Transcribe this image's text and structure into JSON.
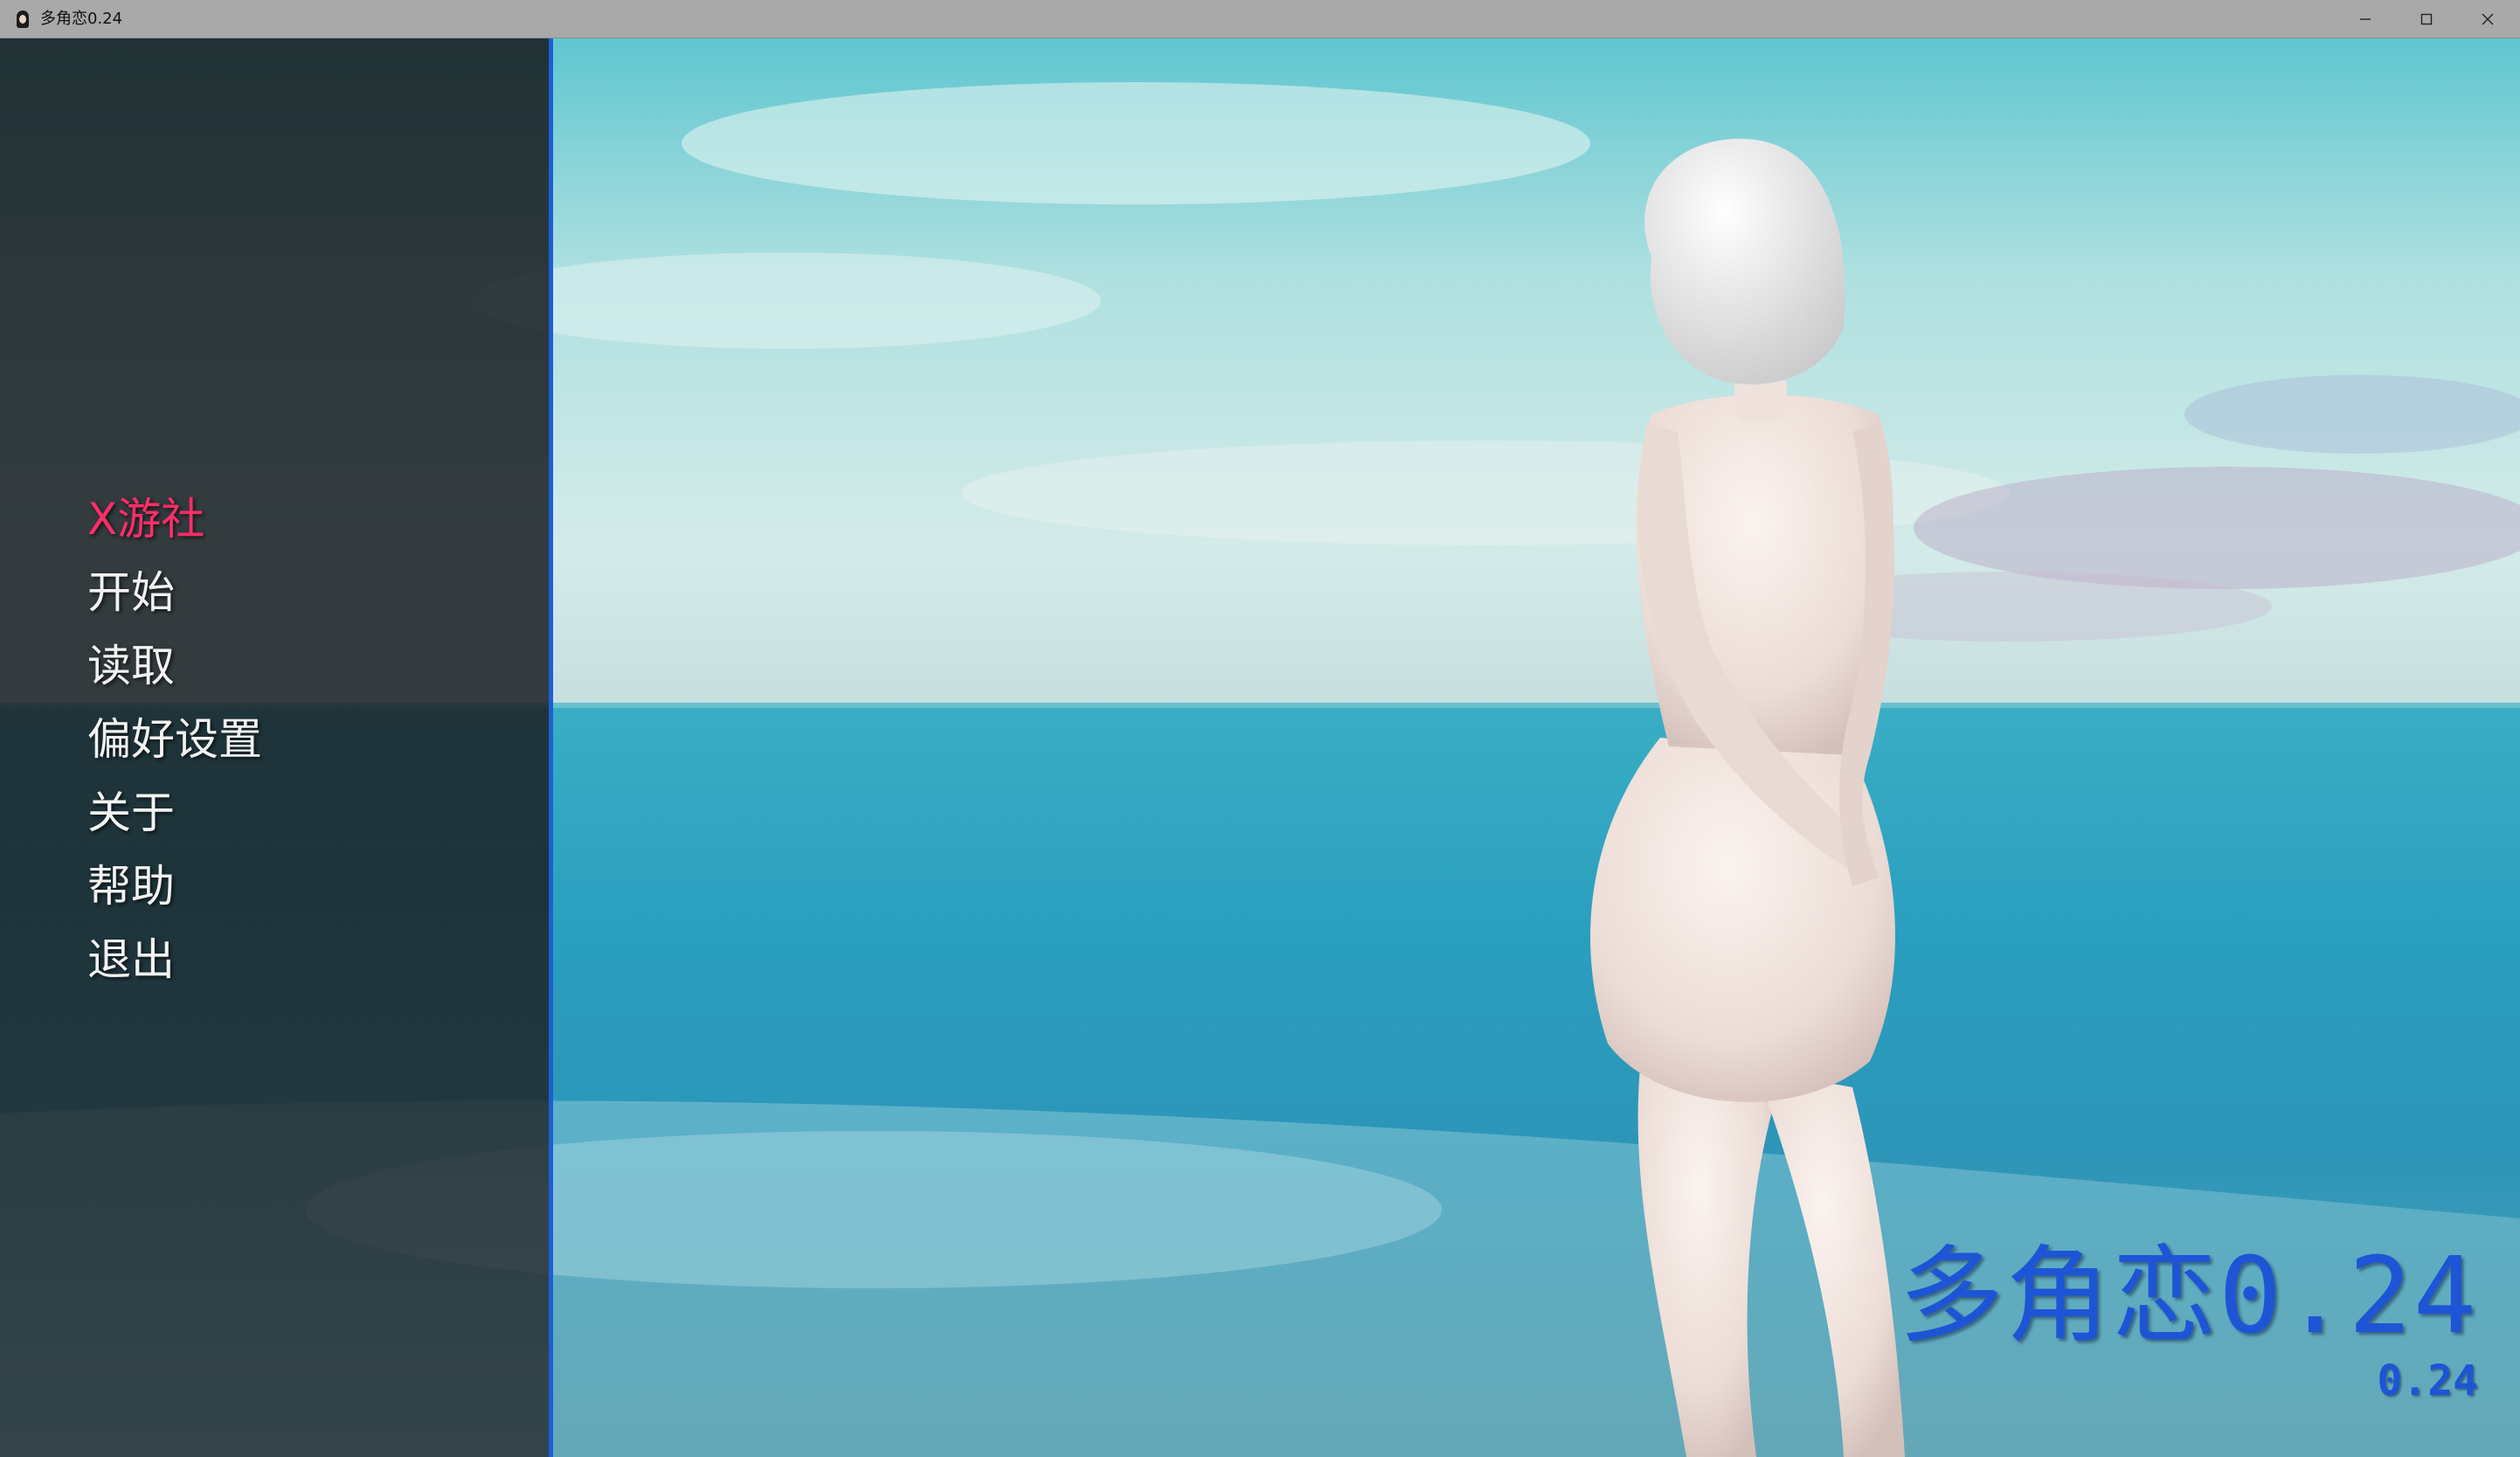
{
  "window": {
    "title": "多角恋0.24",
    "controls": {
      "minimize": "minimize-icon",
      "maximize": "maximize-icon",
      "close": "close-icon"
    }
  },
  "menu": {
    "items": [
      {
        "label": "X游社",
        "active": true
      },
      {
        "label": "开始"
      },
      {
        "label": "读取"
      },
      {
        "label": "偏好设置"
      },
      {
        "label": "关于"
      },
      {
        "label": "帮助"
      },
      {
        "label": "退出"
      }
    ]
  },
  "logo": {
    "title": "多角恋0.24",
    "version": "0.24"
  },
  "colors": {
    "accent_active": "#ff2d6a",
    "menu_edge": "#1c5fd6",
    "logo": "#1d55d6",
    "titlebar": "#a9a9a9"
  }
}
